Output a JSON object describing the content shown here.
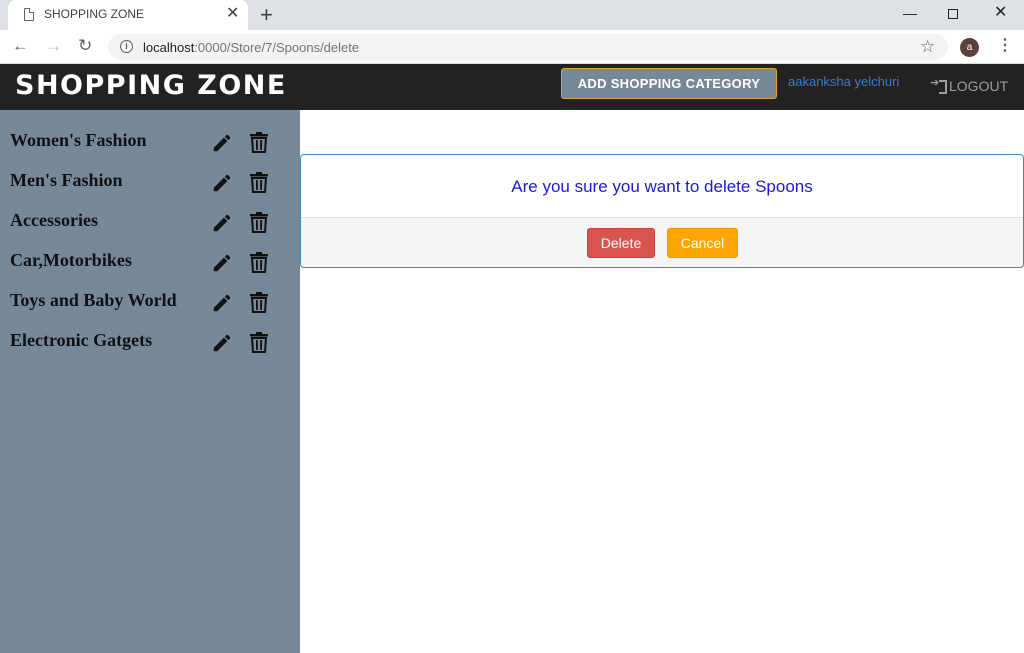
{
  "browser": {
    "tab_title": "SHOPPING ZONE",
    "tab_close": "✕",
    "new_tab": "+",
    "url_host": "localhost",
    "url_path": ":0000/Store/7/Spoons/delete",
    "avatar_letter": "a",
    "icons": [
      "page-icon",
      "close-icon",
      "plus-icon",
      "back-icon",
      "forward-icon",
      "reload-icon",
      "info-icon",
      "star-icon",
      "menu-icon"
    ]
  },
  "header": {
    "brand": "SHOPPING ZONE",
    "add_category_label": "ADD SHOPPING CATEGORY",
    "username": "aakanksha yelchuri",
    "logout_label": "LOGOUT"
  },
  "sidebar": {
    "items": [
      {
        "label": "Women's Fashion"
      },
      {
        "label": "Men's Fashion"
      },
      {
        "label": "Accessories"
      },
      {
        "label": "Car,Motorbikes"
      },
      {
        "label": "Toys and Baby World"
      },
      {
        "label": "Electronic Gatgets"
      }
    ]
  },
  "modal": {
    "message": "Are you sure you want to delete Spoons",
    "delete_label": "Delete",
    "cancel_label": "Cancel"
  },
  "colors": {
    "header_bg": "#222222",
    "sidebar_bg": "#778899",
    "delete_btn": "#d9534f",
    "cancel_btn": "#ffa500",
    "message_text": "#1a1add"
  }
}
